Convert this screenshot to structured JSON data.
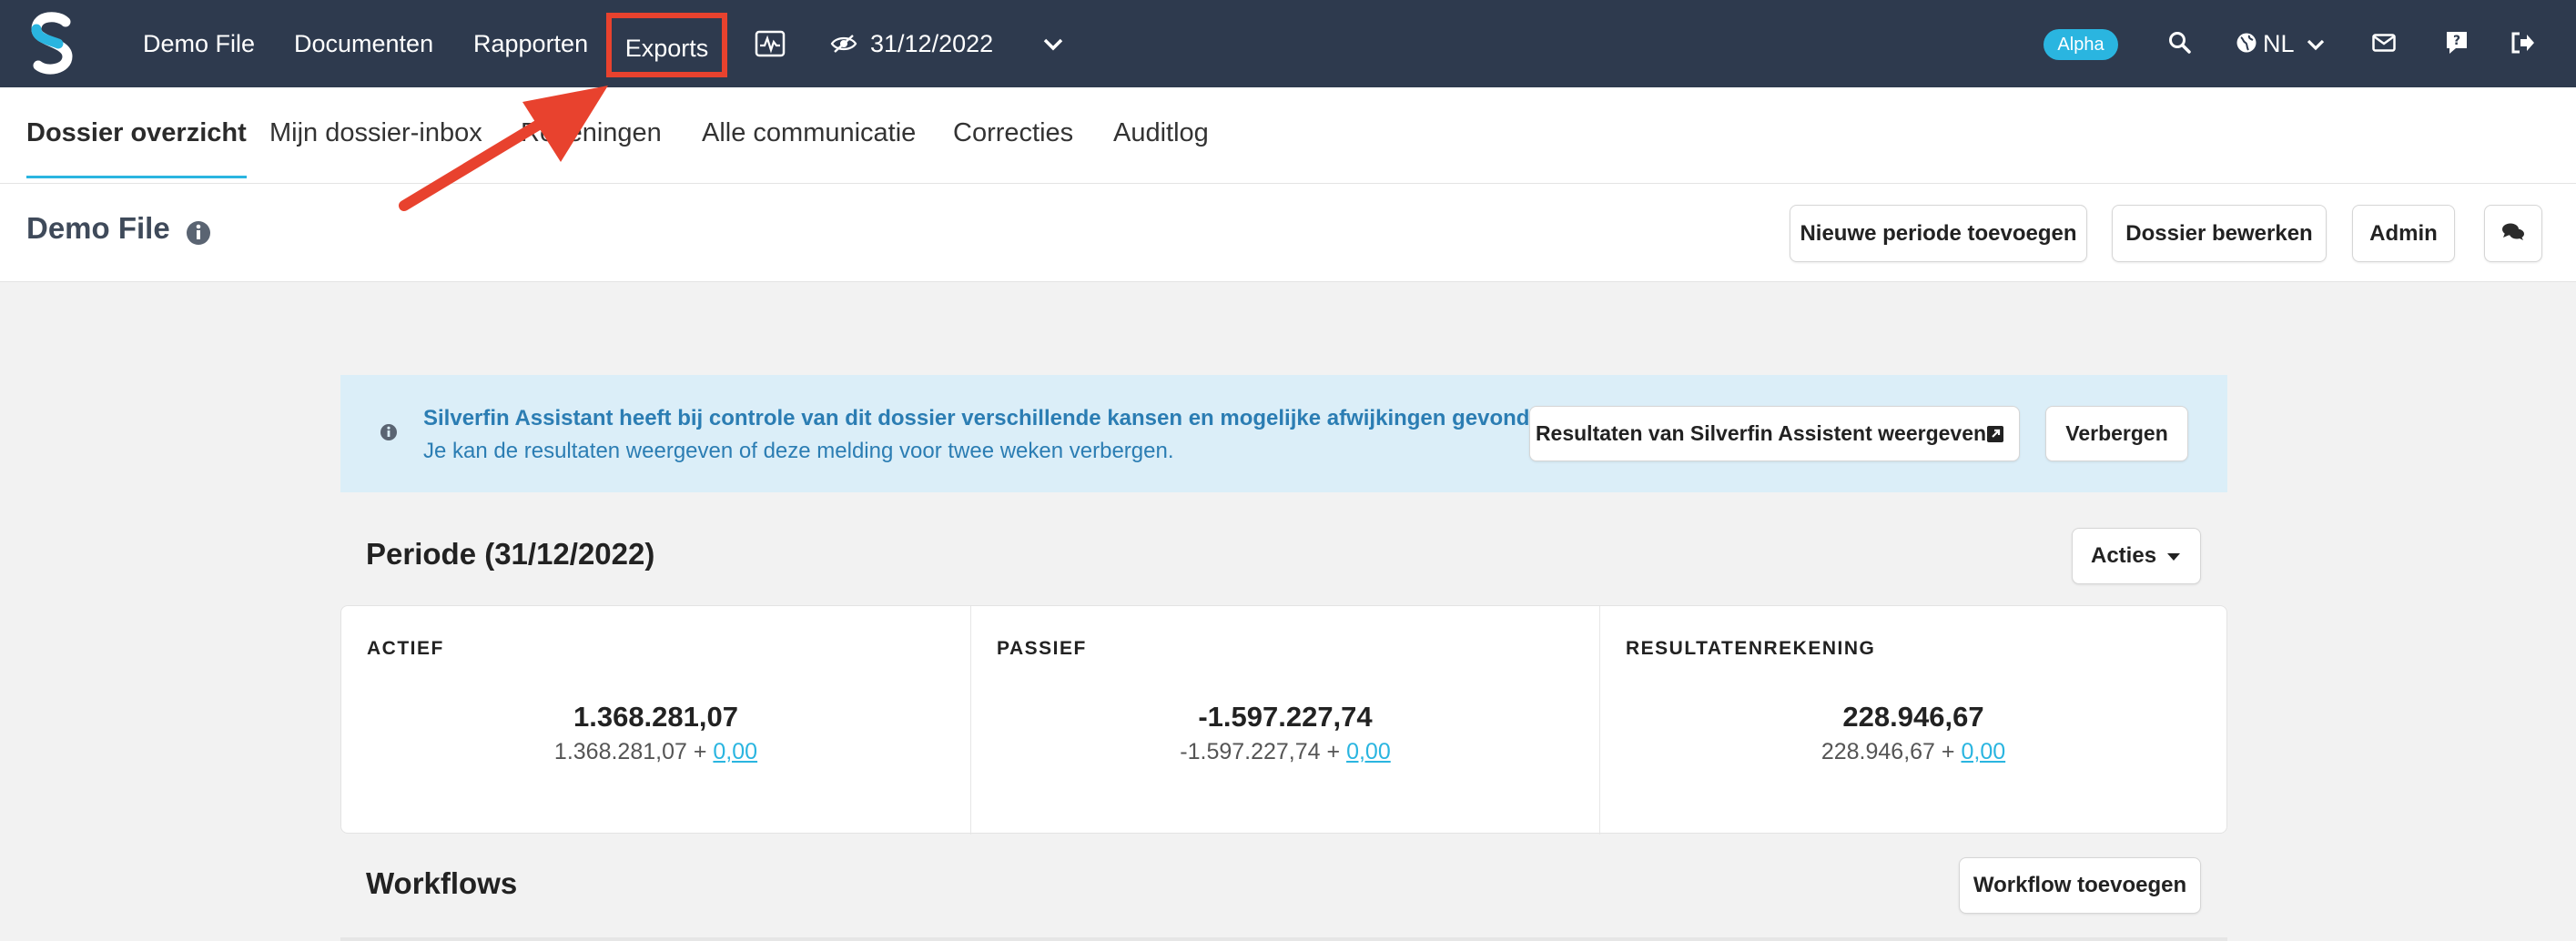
{
  "nav": {
    "items": [
      {
        "label": "Demo File"
      },
      {
        "label": "Documenten"
      },
      {
        "label": "Rapporten"
      },
      {
        "label": "Exports"
      }
    ],
    "period_date": "31/12/2022",
    "alpha_badge": "Alpha",
    "language": "NL"
  },
  "tabs": [
    {
      "label": "Dossier overzicht",
      "active": true
    },
    {
      "label": "Mijn dossier-inbox"
    },
    {
      "label": "Rekeningen"
    },
    {
      "label": "Alle communicatie"
    },
    {
      "label": "Correcties"
    },
    {
      "label": "Auditlog"
    }
  ],
  "header": {
    "title": "Demo File",
    "buttons": {
      "new_period": "Nieuwe periode toevoegen",
      "edit_file": "Dossier bewerken",
      "admin": "Admin"
    }
  },
  "alert": {
    "line1": "Silverfin Assistant heeft bij controle van dit dossier verschillende kansen en mogelijke afwijkingen gevonden.",
    "line2": "Je kan de resultaten weergeven of deze melding voor twee weken verbergen.",
    "show_button": "Resultaten van Silverfin Assistent weergeven",
    "hide_button": "Verbergen"
  },
  "period": {
    "title": "Periode (31/12/2022)",
    "actions_button": "Acties",
    "columns": [
      {
        "label": "ACTIEF",
        "value": "1.368.281,07",
        "base": "1.368.281,07 +",
        "adjust": "0,00"
      },
      {
        "label": "PASSIEF",
        "value": "-1.597.227,74",
        "base": "-1.597.227,74 +",
        "adjust": "0,00"
      },
      {
        "label": "RESULTATENREKENING",
        "value": "228.946,67",
        "base": "228.946,67 +",
        "adjust": "0,00"
      }
    ]
  },
  "workflows": {
    "title": "Workflows",
    "add_button": "Workflow toevoegen"
  },
  "colors": {
    "navbar_bg": "#2e3a4e",
    "accent": "#2ab5e0",
    "highlight": "#e8422e",
    "alert_bg": "#dbeef8",
    "alert_text": "#2b7db3"
  }
}
